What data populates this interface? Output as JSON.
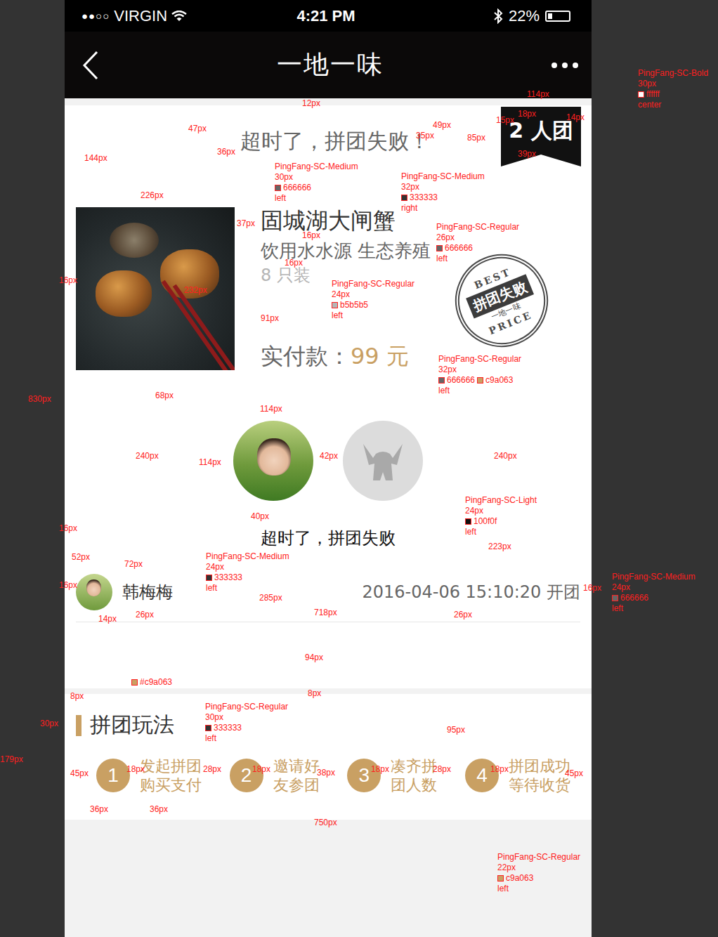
{
  "status_bar": {
    "signal": "●●○○",
    "carrier": "VIRGIN",
    "time": "4:21 PM",
    "battery": "22%",
    "battery_level": 0.22
  },
  "nav": {
    "title": "一地一味"
  },
  "group": {
    "headline": "超时了，拼团失败！",
    "badge": "2 人团"
  },
  "product": {
    "name": "固城湖大闸蟹",
    "subtitle": "饮用水水源 生态养殖",
    "spec": "8 只装",
    "price_label": "实付款：",
    "price": "99 元"
  },
  "stamp": {
    "top": "BEST",
    "main": "拼团失败",
    "sub": "一地一味",
    "bottom": "PRICE"
  },
  "members": {
    "avatars": [
      {
        "kind": "photo"
      },
      {
        "kind": "placeholder"
      }
    ],
    "status": "超时了，拼团失败",
    "leader": {
      "name": "韩梅梅",
      "time": "2016-04-06 15:10:20 开团"
    }
  },
  "rules": {
    "title": "拼团玩法",
    "steps": [
      {
        "number": "1",
        "lines": [
          "发起拼团",
          "购买支付"
        ]
      },
      {
        "number": "2",
        "lines": [
          "邀请好",
          "友参团"
        ]
      },
      {
        "number": "3",
        "lines": [
          "凑齐拼",
          "团人数"
        ]
      },
      {
        "number": "4",
        "lines": [
          "拼团成功",
          "等待收货"
        ]
      }
    ]
  },
  "annotations": {
    "dimensions": [
      "12px",
      "114px",
      "18px",
      "14px",
      "15px",
      "49px",
      "47px",
      "35px",
      "85px",
      "36px",
      "39px",
      "144px",
      "226px",
      "37px",
      "16px",
      "16px",
      "16px",
      "232px",
      "91px",
      "68px",
      "114px",
      "240px",
      "114px",
      "42px",
      "240px",
      "40px",
      "16px",
      "223px",
      "52px",
      "72px",
      "16px",
      "285px",
      "16px",
      "14px",
      "26px",
      "718px",
      "26px",
      "94px",
      "8px",
      "830px",
      "8px",
      "30px",
      "179px",
      "95px",
      "45px",
      "18px",
      "28px",
      "18px",
      "38px",
      "18px",
      "28px",
      "18px",
      "45px",
      "36px",
      "36px",
      "750px"
    ],
    "specs": [
      {
        "font": "PingFang-SC-Bold",
        "size": "30px",
        "colors": [
          {
            "hex": "ffffff",
            "color": "#ffffff"
          }
        ],
        "align": "center"
      },
      {
        "font": "PingFang-SC-Medium",
        "size": "30px",
        "colors": [
          {
            "hex": "666666",
            "color": "#666666"
          }
        ],
        "align": "left"
      },
      {
        "font": "PingFang-SC-Medium",
        "size": "32px",
        "colors": [
          {
            "hex": "333333",
            "color": "#333333"
          }
        ],
        "align": "right"
      },
      {
        "font": "PingFang-SC-Regular",
        "size": "26px",
        "colors": [
          {
            "hex": "666666",
            "color": "#666666"
          }
        ],
        "align": "left"
      },
      {
        "font": "PingFang-SC-Regular",
        "size": "24px",
        "colors": [
          {
            "hex": "b5b5b5",
            "color": "#b5b5b5"
          }
        ],
        "align": "left"
      },
      {
        "font": "PingFang-SC-Regular",
        "size": "32px",
        "colors": [
          {
            "hex": "666666",
            "color": "#666666"
          },
          {
            "hex": "c9a063",
            "color": "#c9a063"
          }
        ],
        "align": "left"
      },
      {
        "font": "PingFang-SC-Light",
        "size": "24px",
        "colors": [
          {
            "hex": "100f0f",
            "color": "#100f0f"
          }
        ],
        "align": "left"
      },
      {
        "font": "PingFang-SC-Medium",
        "size": "24px",
        "colors": [
          {
            "hex": "333333",
            "color": "#333333"
          }
        ],
        "align": "left"
      },
      {
        "font": "PingFang-SC-Medium",
        "size": "24px",
        "colors": [
          {
            "hex": "666666",
            "color": "#666666"
          }
        ],
        "align": "left"
      },
      {
        "font": "",
        "size": "",
        "colors": [
          {
            "hex": "#c9a063",
            "color": "#c9a063"
          }
        ],
        "align": ""
      },
      {
        "font": "PingFang-SC-Regular",
        "size": "30px",
        "colors": [
          {
            "hex": "333333",
            "color": "#333333"
          }
        ],
        "align": "left"
      },
      {
        "font": "PingFang-SC-Regular",
        "size": "22px",
        "colors": [
          {
            "hex": "c9a063",
            "color": "#c9a063"
          }
        ],
        "align": "left"
      }
    ]
  }
}
